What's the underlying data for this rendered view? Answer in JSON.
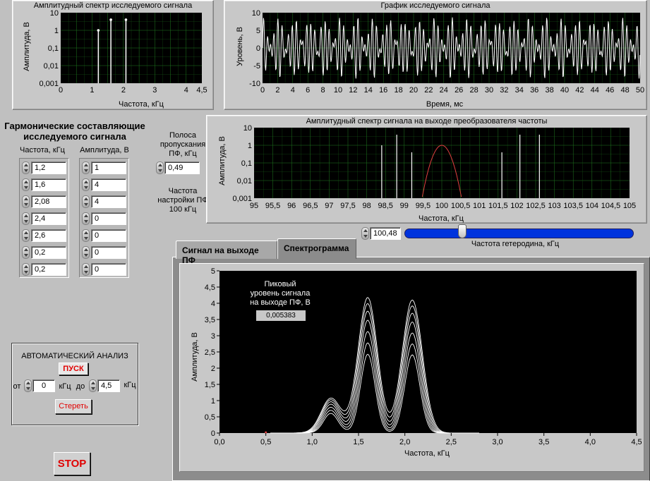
{
  "spectrum_panel": {
    "title": "Амплитудный спектр исследуемого сигнала",
    "xlabel": "Частота, кГц",
    "ylabel": "Амплитуда, В",
    "x_ticks": [
      "0",
      "1",
      "2",
      "3",
      "4",
      "4,5"
    ],
    "y_ticks": [
      "10",
      "1",
      "0,1",
      "0,01",
      "0,001"
    ]
  },
  "time_panel": {
    "title": "График  исследуемого сигнала",
    "xlabel": "Время, мс",
    "ylabel": "Уровень, В",
    "x_ticks": [
      "0",
      "2",
      "4",
      "6",
      "8",
      "10",
      "12",
      "14",
      "16",
      "18",
      "20",
      "22",
      "24",
      "26",
      "28",
      "30",
      "32",
      "34",
      "36",
      "38",
      "40",
      "42",
      "44",
      "46",
      "48",
      "50"
    ],
    "y_ticks": [
      "10",
      "5",
      "0",
      "-5",
      "-10"
    ]
  },
  "converter_panel": {
    "title": "Амплитудный спектр сигнала на выходе преобразователя частоты",
    "xlabel": "Частота, кГц",
    "ylabel": "Амплитуда, В",
    "x_ticks": [
      "95",
      "95,5",
      "96",
      "96,5",
      "97",
      "97,5",
      "98",
      "98,5",
      "99",
      "99,5",
      "100",
      "100,5",
      "101",
      "101,5",
      "102",
      "102,5",
      "103",
      "103,5",
      "104",
      "104,5",
      "105"
    ],
    "y_ticks": [
      "10",
      "1",
      "0,1",
      "0,01",
      "0,001"
    ]
  },
  "harmonics": {
    "title_line1": "Гармонические составляющие",
    "title_line2": "исследуемого сигнала",
    "freq_header": "Частота, кГц",
    "amp_header": "Амплитуда, В",
    "frequencies": [
      "1,2",
      "1,6",
      "2,08",
      "2,4",
      "2,6",
      "0,2",
      "0,2"
    ],
    "amplitudes": [
      "1",
      "4",
      "4",
      "0",
      "0",
      "0",
      "0"
    ]
  },
  "filter": {
    "band_label_1": "Полоса",
    "band_label_2": "пропускания",
    "band_label_3": "ПФ, кГц",
    "bandwidth": "0,49",
    "tune_label_1": "Частота",
    "tune_label_2": "настройки ПФ",
    "tune_label_3": "100 кГц"
  },
  "heterodyne": {
    "value": "100,48",
    "label": "Частота гетеродина, кГц",
    "slider_fraction": 0.24
  },
  "tabs": {
    "tab1": "Сигнал на выходе ПФ",
    "tab2": "Спектрограмма",
    "active": "tab2"
  },
  "spectrogram": {
    "xlabel": "Частота, кГц",
    "ylabel": "Амплитуда, В",
    "x_ticks": [
      "0,0",
      "0,5",
      "1,0",
      "1,5",
      "2,0",
      "2,5",
      "3,0",
      "3,5",
      "4,0",
      "4,5"
    ],
    "y_ticks": [
      "5",
      "4,5",
      "4",
      "3,5",
      "3",
      "2,5",
      "2",
      "1,5",
      "1",
      "0,5",
      "0"
    ],
    "peak_label_1": "Пиковый",
    "peak_label_2": "уровень сигнала",
    "peak_label_3": "на выходе ПФ, В",
    "peak_value": "0,005383"
  },
  "auto_analysis": {
    "title": "АВТОМАТИЧЕСКИЙ АНАЛИЗ",
    "start_label": "ПУСК",
    "from_label": "от",
    "from_value": "0",
    "unit1": "кГц",
    "to_label": "до",
    "to_value": "4,5",
    "unit2": "кГц",
    "clear_label": "Стереть"
  },
  "stop_label": "STOP",
  "chart_data": [
    {
      "type": "bar",
      "name": "spectrum",
      "x": [
        1.2,
        1.6,
        2.08
      ],
      "values": [
        1,
        4,
        4
      ],
      "xlim": [
        0,
        4.5
      ],
      "ylim": [
        0.001,
        10
      ],
      "yscale": "log",
      "grid": true
    },
    {
      "type": "line",
      "name": "time",
      "xlim": [
        0,
        50
      ],
      "ylim": [
        -10,
        10
      ],
      "grid": true
    },
    {
      "type": "bar",
      "name": "converter",
      "x": [
        98.4,
        98.8,
        99.2,
        101.6,
        102.08,
        102.6
      ],
      "values": [
        1,
        4,
        0.4,
        0.4,
        4,
        4
      ],
      "xlim": [
        95,
        105
      ],
      "ylim": [
        0.001,
        10
      ],
      "yscale": "log",
      "grid": true,
      "filter_center": 100,
      "filter_peak": 1
    },
    {
      "type": "line",
      "name": "spectrogram",
      "xlim": [
        0,
        4.5
      ],
      "ylim": [
        0,
        5
      ],
      "grid": false,
      "peaks": [
        {
          "x": 1.2,
          "y": 1.0
        },
        {
          "x": 1.6,
          "y": 4.1
        },
        {
          "x": 2.08,
          "y": 4.1
        }
      ]
    }
  ]
}
